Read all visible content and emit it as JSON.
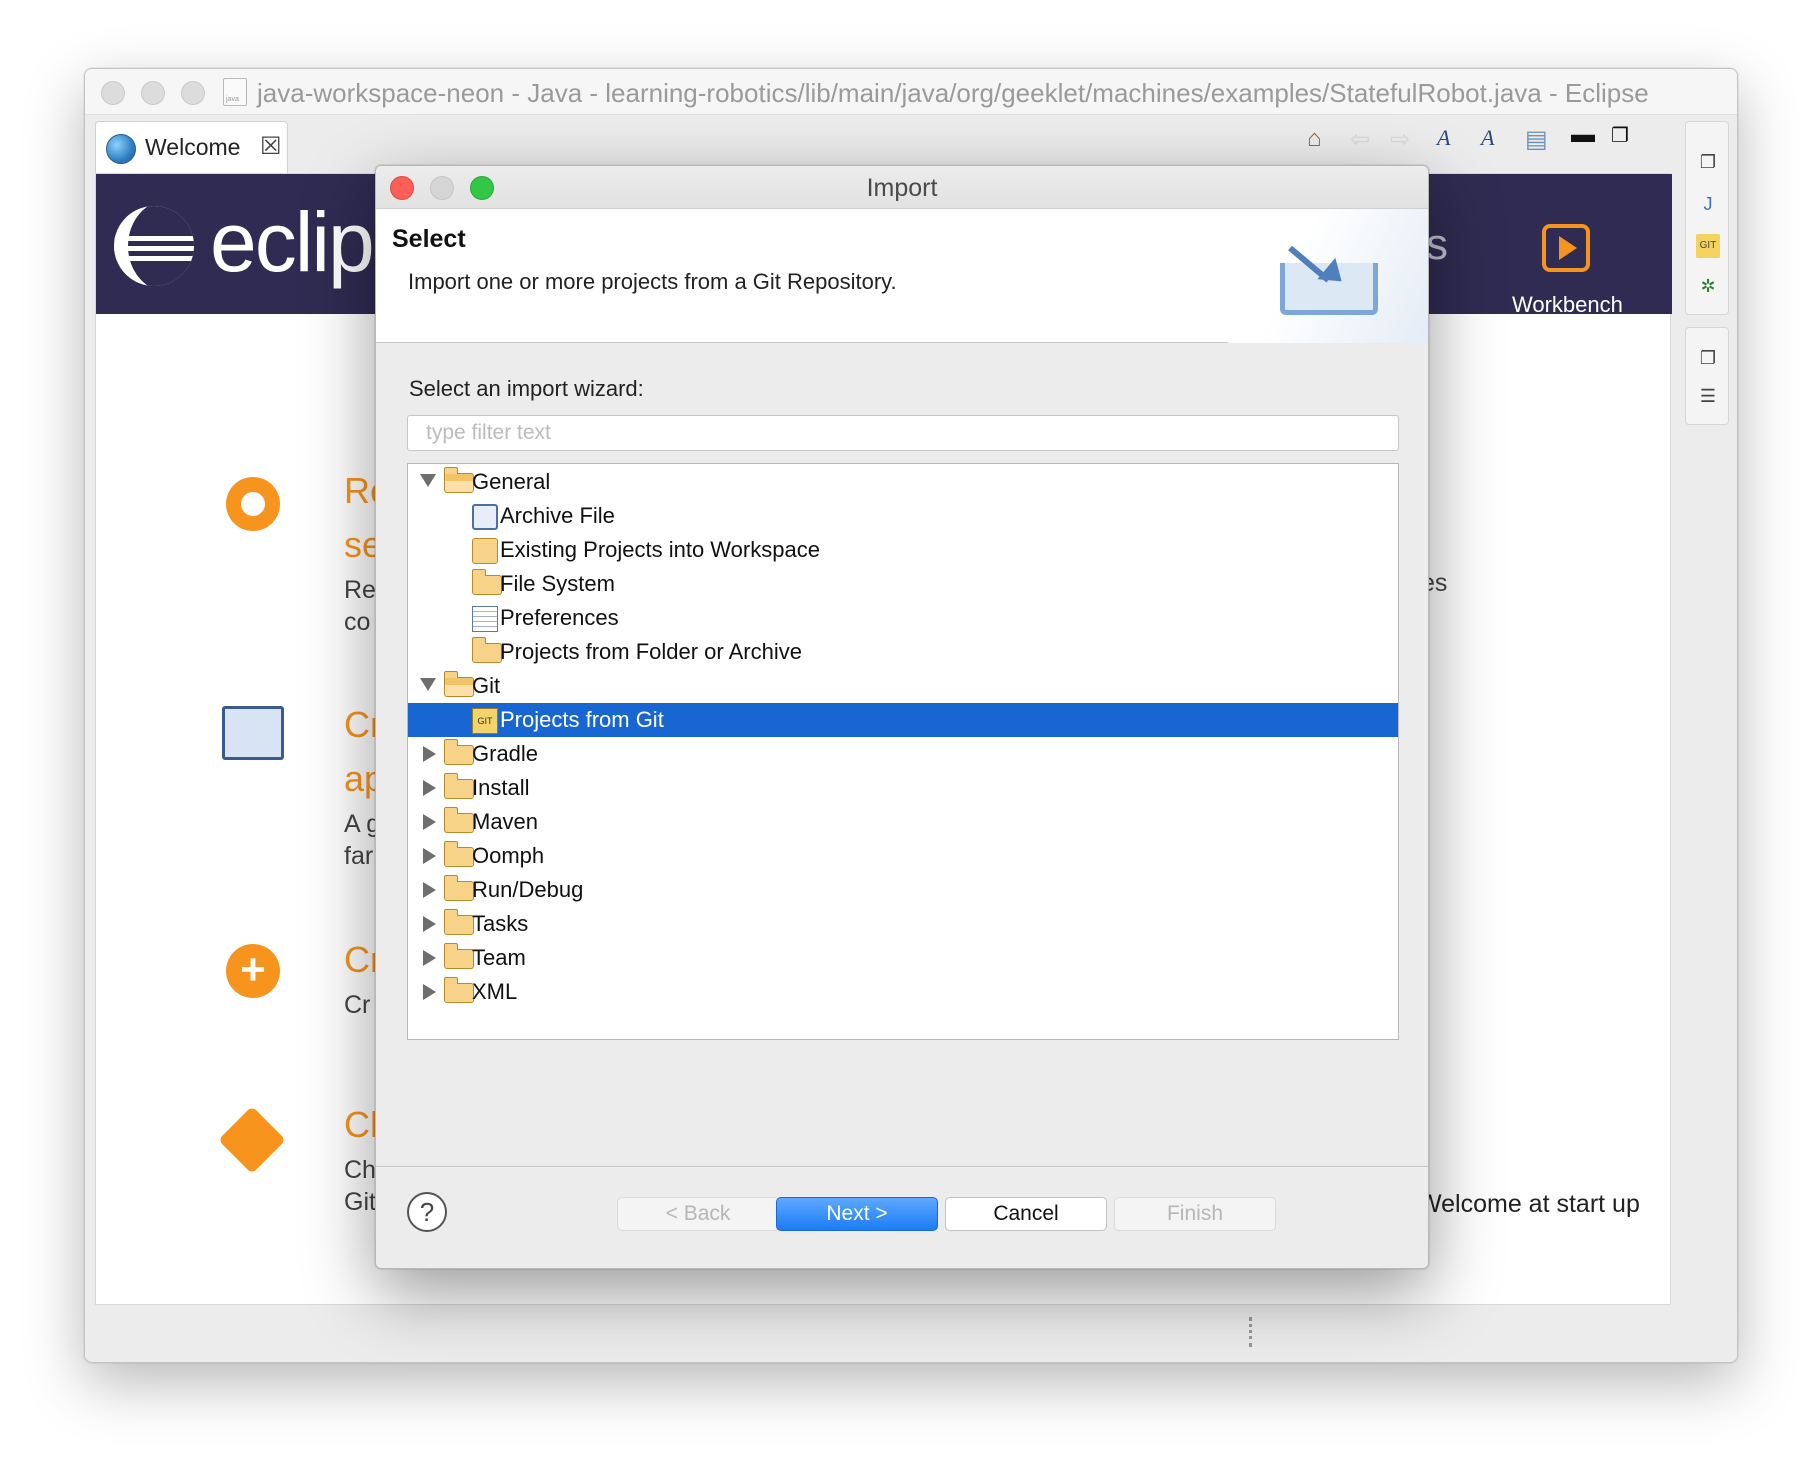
{
  "window": {
    "title": "java-workspace-neon - Java - learning-robotics/lib/main/java/org/geeklet/machines/examples/StatefulRobot.java - Eclipse"
  },
  "tabs": [
    {
      "label": "Welcome",
      "close": "☒"
    }
  ],
  "welcome": {
    "logo_text": "eclip",
    "banner_partial": "s",
    "workbench_label": "Workbench",
    "items": [
      {
        "title1": "Re",
        "title2": "se",
        "text1": "Re",
        "text2": "co"
      },
      {
        "title1": "Cr",
        "title2": "ap",
        "text1": "A g",
        "text2": "far"
      },
      {
        "title1": "Cr",
        "text1": "Cr"
      },
      {
        "title1": "Ch",
        "text1": "Ch",
        "text2": "Git"
      }
    ],
    "right_partial": "es",
    "startup_text": "Welcome at start up"
  },
  "dialog": {
    "title": "Import",
    "header_title": "Select",
    "header_desc": "Import one or more projects from a Git Repository.",
    "select_label": "Select an import wizard:",
    "filter_placeholder": "type filter text",
    "tree": [
      {
        "label": "General",
        "type": "folder",
        "expanded": true
      },
      {
        "label": "Archive File",
        "type": "item",
        "icon": "archive-file-icon"
      },
      {
        "label": "Existing Projects into Workspace",
        "type": "item",
        "icon": "existing-projects-icon"
      },
      {
        "label": "File System",
        "type": "item",
        "icon": "file-system-folder-icon"
      },
      {
        "label": "Preferences",
        "type": "item",
        "icon": "preferences-icon"
      },
      {
        "label": "Projects from Folder or Archive",
        "type": "item",
        "icon": "folder-archive-icon"
      },
      {
        "label": "Git",
        "type": "folder",
        "expanded": true
      },
      {
        "label": "Projects from Git",
        "type": "item",
        "icon": "git-icon",
        "selected": true
      },
      {
        "label": "Gradle",
        "type": "folder",
        "expanded": false
      },
      {
        "label": "Install",
        "type": "folder",
        "expanded": false
      },
      {
        "label": "Maven",
        "type": "folder",
        "expanded": false
      },
      {
        "label": "Oomph",
        "type": "folder",
        "expanded": false
      },
      {
        "label": "Run/Debug",
        "type": "folder",
        "expanded": false
      },
      {
        "label": "Tasks",
        "type": "folder",
        "expanded": false
      },
      {
        "label": "Team",
        "type": "folder",
        "expanded": false
      },
      {
        "label": "XML",
        "type": "folder",
        "expanded": false
      }
    ],
    "buttons": {
      "help": "?",
      "back": "< Back",
      "next": "Next >",
      "cancel": "Cancel",
      "finish": "Finish"
    }
  },
  "colors": {
    "accent": "#1866d2",
    "eclipse_orange": "#f7941d",
    "banner": "#2f2b52"
  }
}
